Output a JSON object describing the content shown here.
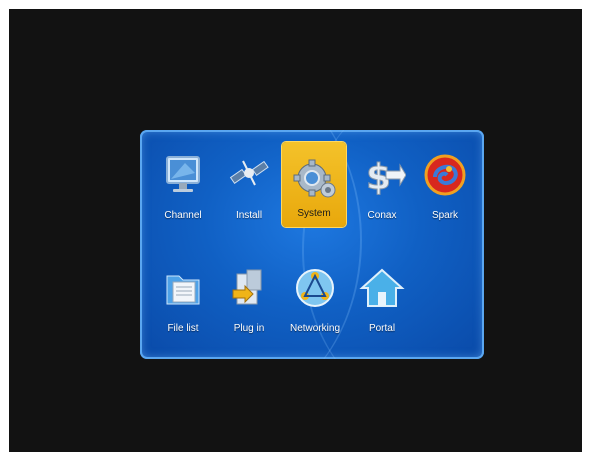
{
  "menu": {
    "items": [
      {
        "label": "Channel",
        "icon": "monitor-icon"
      },
      {
        "label": "Install",
        "icon": "satellite-icon"
      },
      {
        "label": "System",
        "icon": "gear-icon",
        "selected": true
      },
      {
        "label": "Conax",
        "icon": "dollar-icon"
      },
      {
        "label": "Spark",
        "icon": "spark-logo-icon"
      },
      {
        "label": "File list",
        "icon": "folder-icon"
      },
      {
        "label": "Plug in",
        "icon": "plugin-icon"
      },
      {
        "label": "Networking",
        "icon": "network-icon"
      },
      {
        "label": "Portal",
        "icon": "home-icon"
      }
    ]
  },
  "colors": {
    "panel": "#1060c4",
    "selected": "#f0b418",
    "background": "#121212"
  }
}
